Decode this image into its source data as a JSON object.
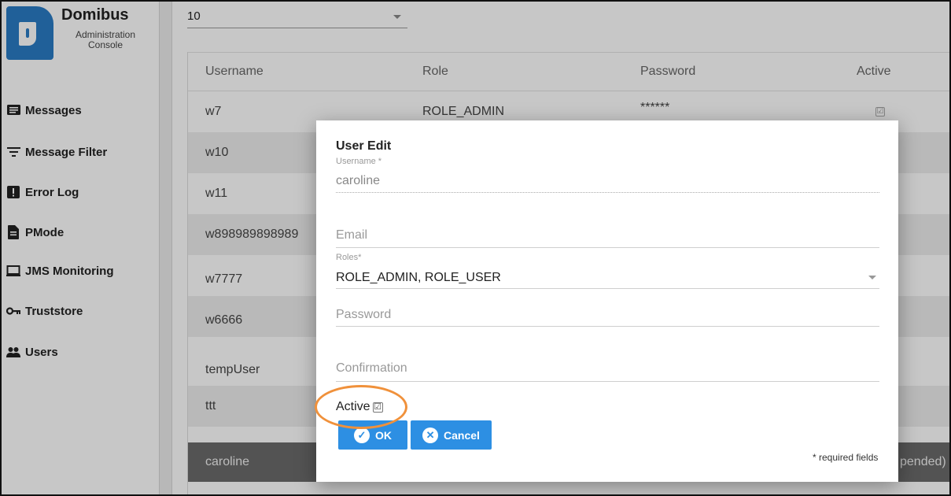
{
  "app": {
    "brand_title": "Domibus",
    "brand_subtitle": "Administration Console"
  },
  "sidebar": {
    "items": [
      {
        "label": "Messages",
        "icon": "message-list-icon"
      },
      {
        "label": "Message Filter",
        "icon": "filter-icon"
      },
      {
        "label": "Error Log",
        "icon": "error-icon"
      },
      {
        "label": "PMode",
        "icon": "document-icon"
      },
      {
        "label": "JMS Monitoring",
        "icon": "monitor-icon"
      },
      {
        "label": "Truststore",
        "icon": "key-icon"
      },
      {
        "label": "Users",
        "icon": "users-icon"
      }
    ]
  },
  "page_size": {
    "selected": "10"
  },
  "table": {
    "columns": [
      "Username",
      "Role",
      "Password",
      "Active"
    ],
    "rows": [
      {
        "username": "w7",
        "role": "ROLE_ADMIN",
        "password": "******",
        "active": "☑"
      },
      {
        "username": "w10",
        "role": "",
        "password": "",
        "active": ""
      },
      {
        "username": "w11",
        "role": "",
        "password": "",
        "active": ""
      },
      {
        "username": "w898989898989",
        "role": "",
        "password": "",
        "active": ""
      },
      {
        "username": "w7777",
        "role": "",
        "password": "",
        "active": ""
      },
      {
        "username": "w6666",
        "role": "",
        "password": "",
        "active": ""
      },
      {
        "username": "tempUser",
        "role": "",
        "password": "",
        "active": ""
      },
      {
        "username": "ttt",
        "role": "",
        "password": "",
        "active": ""
      },
      {
        "username": "caroline",
        "role": "",
        "password": "",
        "active": "pended)"
      }
    ]
  },
  "dialog": {
    "title": "User Edit",
    "username_label": "Username *",
    "username_value": "caroline",
    "email_placeholder": "Email",
    "roles_label": "Roles*",
    "roles_value": "ROLE_ADMIN, ROLE_USER",
    "password_placeholder": "Password",
    "confirmation_placeholder": "Confirmation",
    "active_label": "Active",
    "active_checked": true,
    "active_mark": "☑",
    "ok_label": "OK",
    "ok_icon_glyph": "✓",
    "cancel_label": "Cancel",
    "cancel_icon_glyph": "✕",
    "required_note": "* required fields"
  },
  "colors": {
    "brand_blue": "#2a7bc4",
    "button_blue": "#2d8fe3",
    "highlight_orange": "#f0913b",
    "selected_row": "#6b6b6b"
  }
}
